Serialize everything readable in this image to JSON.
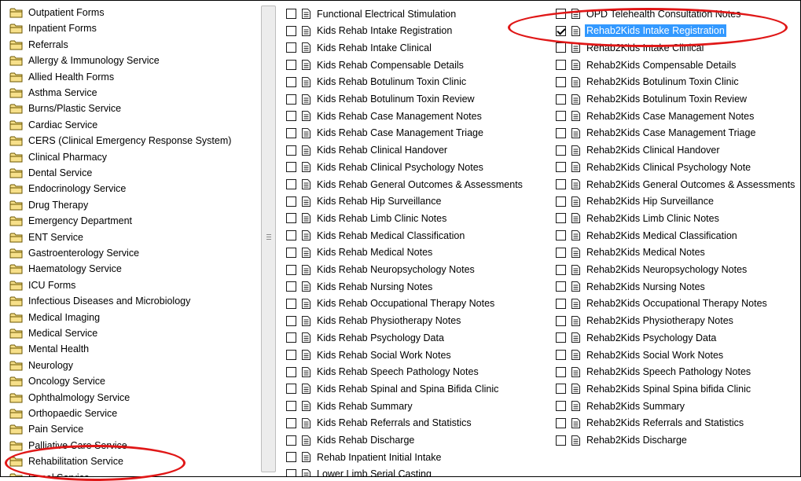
{
  "left_panel": {
    "items": [
      "Outpatient Forms",
      "Inpatient Forms",
      "Referrals",
      "Allergy & Immunology Service",
      "Allied Health Forms",
      "Asthma Service",
      "Burns/Plastic Service",
      "Cardiac Service",
      "CERS (Clinical Emergency Response System)",
      "Clinical Pharmacy",
      "Dental Service",
      "Endocrinology Service",
      "Drug Therapy",
      "Emergency Department",
      "ENT Service",
      "Gastroenterology Service",
      "Haematology Service",
      "ICU Forms",
      "Infectious Diseases and Microbiology",
      "Medical Imaging",
      "Medical Service",
      "Mental Health",
      "Neurology",
      "Oncology Service",
      "Ophthalmology Service",
      "Orthopaedic Service",
      "Pain Service",
      "Palliative Care Service",
      "Rehabilitation Service",
      "Renal Service"
    ]
  },
  "forms_col1": {
    "items": [
      {
        "label": "Functional Electrical Stimulation",
        "checked": false
      },
      {
        "label": "Kids Rehab Intake Registration",
        "checked": false
      },
      {
        "label": "Kids Rehab Intake Clinical",
        "checked": false
      },
      {
        "label": "Kids Rehab Compensable Details",
        "checked": false
      },
      {
        "label": "Kids Rehab Botulinum Toxin Clinic",
        "checked": false
      },
      {
        "label": "Kids Rehab Botulinum Toxin Review",
        "checked": false
      },
      {
        "label": "Kids Rehab Case Management Notes",
        "checked": false
      },
      {
        "label": "Kids Rehab Case Management Triage",
        "checked": false
      },
      {
        "label": "Kids Rehab Clinical Handover",
        "checked": false
      },
      {
        "label": "Kids Rehab Clinical Psychology Notes",
        "checked": false
      },
      {
        "label": "Kids Rehab General Outcomes & Assessments",
        "checked": false
      },
      {
        "label": "Kids Rehab Hip Surveillance",
        "checked": false
      },
      {
        "label": "Kids Rehab Limb Clinic Notes",
        "checked": false
      },
      {
        "label": "Kids Rehab Medical Classification",
        "checked": false
      },
      {
        "label": "Kids Rehab Medical Notes",
        "checked": false
      },
      {
        "label": "Kids Rehab Neuropsychology Notes",
        "checked": false
      },
      {
        "label": "Kids Rehab Nursing Notes",
        "checked": false
      },
      {
        "label": "Kids Rehab Occupational Therapy Notes",
        "checked": false
      },
      {
        "label": "Kids Rehab Physiotherapy Notes",
        "checked": false
      },
      {
        "label": "Kids Rehab Psychology Data",
        "checked": false
      },
      {
        "label": "Kids Rehab Social Work Notes",
        "checked": false
      },
      {
        "label": "Kids Rehab Speech Pathology Notes",
        "checked": false
      },
      {
        "label": "Kids Rehab Spinal and Spina Bifida Clinic",
        "checked": false
      },
      {
        "label": "Kids Rehab Summary",
        "checked": false
      },
      {
        "label": "Kids Rehab Referrals and Statistics",
        "checked": false
      },
      {
        "label": "Kids Rehab Discharge",
        "checked": false
      },
      {
        "label": "Rehab Inpatient Initial Intake",
        "checked": false
      },
      {
        "label": "Lower Limb Serial Casting",
        "checked": false
      }
    ]
  },
  "forms_col2": {
    "items": [
      {
        "label": "OPD Telehealth Consultation Notes",
        "checked": false
      },
      {
        "label": "Rehab2Kids Intake Registration",
        "checked": true,
        "selected": true
      },
      {
        "label": "Rehab2Kids Intake Clinical",
        "checked": false
      },
      {
        "label": "Rehab2Kids Compensable Details",
        "checked": false
      },
      {
        "label": "Rehab2Kids Botulinum Toxin Clinic",
        "checked": false
      },
      {
        "label": "Rehab2Kids Botulinum Toxin Review",
        "checked": false
      },
      {
        "label": "Rehab2Kids Case Management Notes",
        "checked": false
      },
      {
        "label": "Rehab2Kids Case Management Triage",
        "checked": false
      },
      {
        "label": "Rehab2Kids Clinical Handover",
        "checked": false
      },
      {
        "label": "Rehab2Kids Clinical Psychology Note",
        "checked": false
      },
      {
        "label": "Rehab2Kids General Outcomes & Assessments",
        "checked": false
      },
      {
        "label": "Rehab2Kids Hip Surveillance",
        "checked": false
      },
      {
        "label": "Rehab2Kids Limb Clinic Notes",
        "checked": false
      },
      {
        "label": "Rehab2Kids Medical Classification",
        "checked": false
      },
      {
        "label": "Rehab2Kids Medical Notes",
        "checked": false
      },
      {
        "label": "Rehab2Kids Neuropsychology Notes",
        "checked": false
      },
      {
        "label": "Rehab2Kids Nursing Notes",
        "checked": false
      },
      {
        "label": "Rehab2Kids Occupational Therapy Notes",
        "checked": false
      },
      {
        "label": "Rehab2Kids Physiotherapy Notes",
        "checked": false
      },
      {
        "label": "Rehab2Kids Psychology Data",
        "checked": false
      },
      {
        "label": "Rehab2Kids Social Work Notes",
        "checked": false
      },
      {
        "label": "Rehab2Kids Speech Pathology Notes",
        "checked": false
      },
      {
        "label": "Rehab2Kids Spinal Spina bifida Clinic",
        "checked": false
      },
      {
        "label": "Rehab2Kids Summary",
        "checked": false
      },
      {
        "label": "Rehab2Kids Referrals and Statistics",
        "checked": false
      },
      {
        "label": "Rehab2Kids Discharge",
        "checked": false
      }
    ]
  },
  "colors": {
    "selection": "#3399ff",
    "annotation": "#e01717",
    "folder_fill": "#f7e08a",
    "folder_stroke": "#6b5600"
  },
  "icons": {
    "folder": "folder-icon",
    "document": "document-icon",
    "checkbox": "checkbox"
  }
}
